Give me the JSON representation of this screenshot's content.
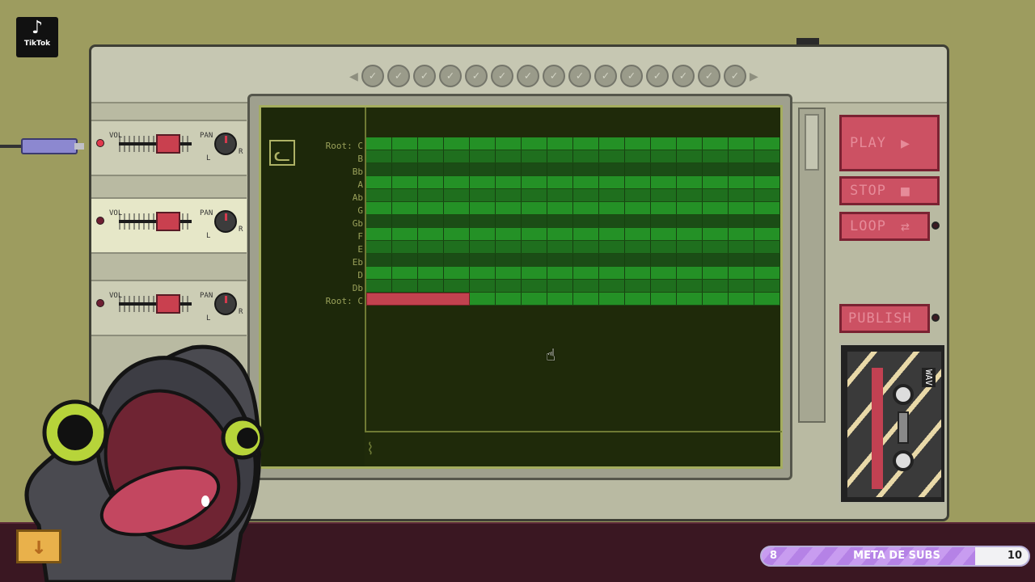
{
  "overlay": {
    "tiktok_label": "TikTok",
    "goal_label": "META DE SUBS",
    "goal_current": "8",
    "goal_target": "10",
    "goal_fraction": 0.8
  },
  "sequencer": {
    "note_rows": [
      "Root: C",
      "B",
      "Bb",
      "A",
      "Ab",
      "G",
      "Gb",
      "F",
      "E",
      "Eb",
      "D",
      "Db",
      "Root: C"
    ],
    "active_note": {
      "row": 12,
      "start_step": 0,
      "length_steps": 4
    }
  },
  "controls": {
    "play_label": "PLAY",
    "stop_label": "STOP",
    "loop_label": "LOOP",
    "publish_label": "PUBLISH",
    "cassette_label": "WAV"
  },
  "mixer": {
    "channels": [
      {
        "vol": "VOL",
        "pan": "PAN",
        "l": "L",
        "r": "R"
      },
      {
        "vol": "VOL",
        "pan": "PAN",
        "l": "L",
        "r": "R"
      },
      {
        "vol": "VOL",
        "pan": "PAN",
        "l": "L",
        "r": "R"
      }
    ]
  },
  "colors": {
    "accent_red": "#cc5163",
    "grid_green": "#249126",
    "screen_bg": "#1f2a0a",
    "goal_purple": "#b582e6"
  }
}
